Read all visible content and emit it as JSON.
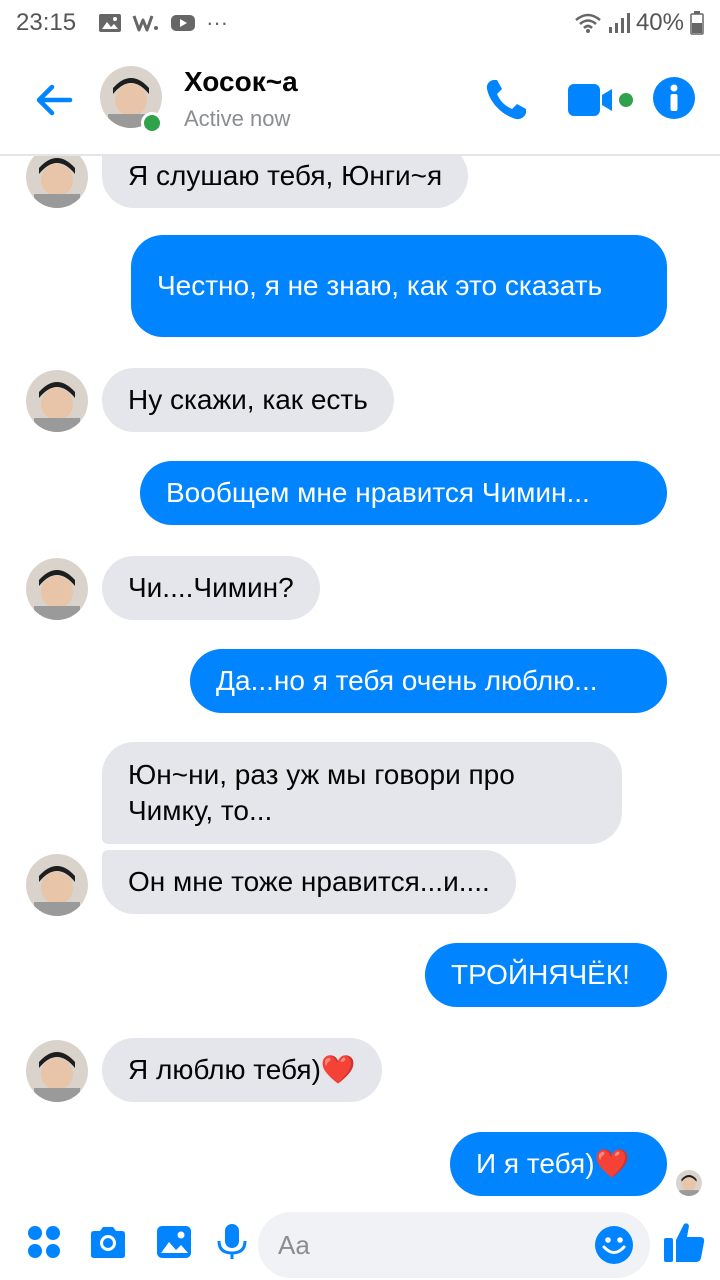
{
  "status_bar": {
    "time": "23:15",
    "icons": [
      "gallery-icon",
      "w-app-icon",
      "youtube-icon",
      "more-dots-icon"
    ],
    "battery": "40%"
  },
  "header": {
    "contact_name": "Хосок~а",
    "status": "Active now",
    "accent_color": "#0084ff"
  },
  "messages": [
    {
      "side": "in",
      "text": "Я слушаю тебя, Юнги~я"
    },
    {
      "side": "out",
      "text": "Честно, я не знаю, как это сказать"
    },
    {
      "side": "in",
      "text": "Ну скажи, как есть"
    },
    {
      "side": "out",
      "text": "Вообщем мне нравится Чимин..."
    },
    {
      "side": "in",
      "text": "Чи....Чимин?"
    },
    {
      "side": "out",
      "text": "Да...но я тебя очень люблю..."
    },
    {
      "side": "in",
      "text": "Юн~ни, раз уж мы говори про Чимку, то..."
    },
    {
      "side": "in",
      "text": "Он мне тоже нравится...и...."
    },
    {
      "side": "out",
      "text": "ТРОЙНЯЧЁК!"
    },
    {
      "side": "in",
      "text": "Я люблю тебя)",
      "emoji": "❤️"
    },
    {
      "side": "out",
      "text": "И я тебя)",
      "emoji": "❤️"
    }
  ],
  "composer": {
    "placeholder": "Aa",
    "icons": [
      "menu-icon",
      "camera-icon",
      "image-icon",
      "microphone-icon",
      "emoji-icon",
      "thumbs-up-icon"
    ]
  }
}
